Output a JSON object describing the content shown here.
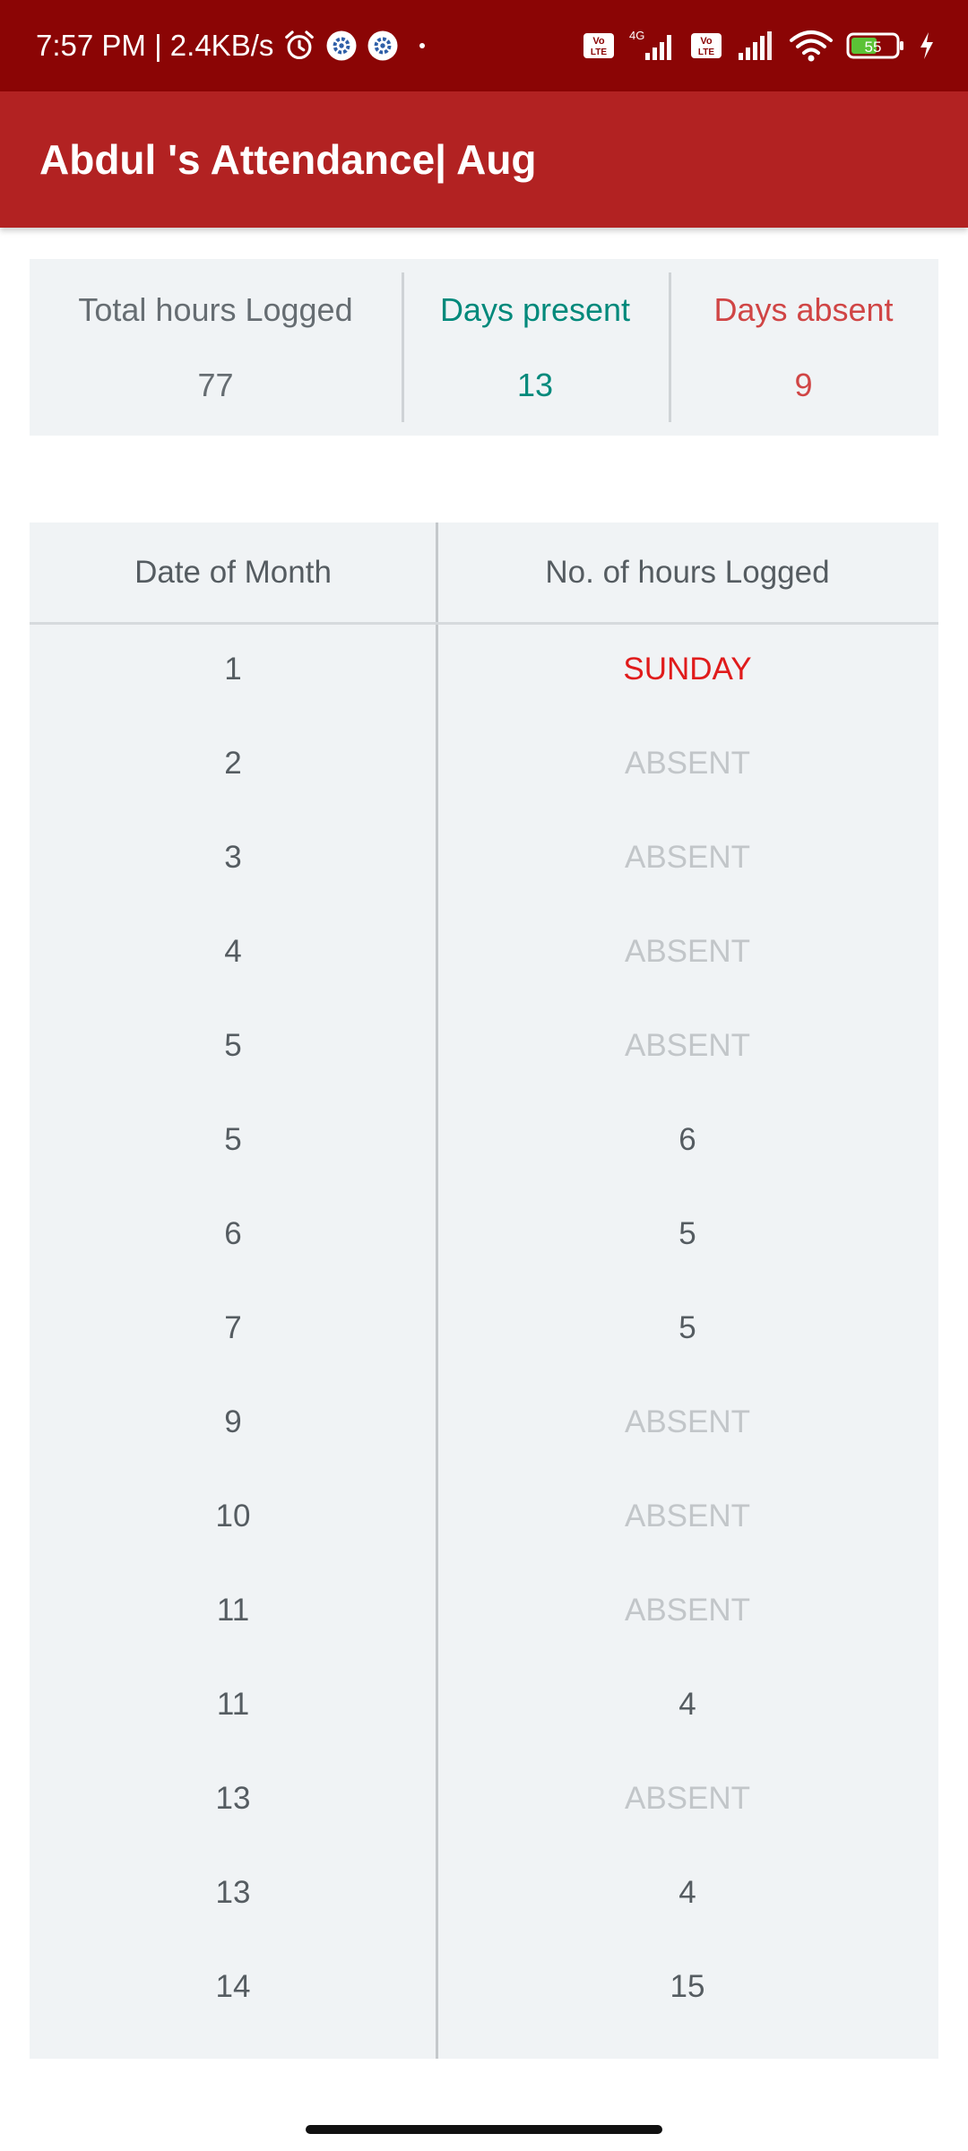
{
  "status_bar": {
    "time": "7:57 PM | 2.4KB/s",
    "battery": "55",
    "network_label": "4G",
    "volte": "Vo LTE"
  },
  "app_bar": {
    "title": "Abdul 's Attendance| Aug"
  },
  "summary": {
    "total_hours_label": "Total hours Logged",
    "total_hours_value": "77",
    "days_present_label": "Days present",
    "days_present_value": "13",
    "days_absent_label": "Days absent",
    "days_absent_value": "9"
  },
  "table": {
    "headers": [
      "Date of Month",
      "No. of hours Logged"
    ],
    "rows": [
      {
        "date": "1",
        "hours": "SUNDAY",
        "status": "sunday"
      },
      {
        "date": "2",
        "hours": "ABSENT",
        "status": "absent"
      },
      {
        "date": "3",
        "hours": "ABSENT",
        "status": "absent"
      },
      {
        "date": "4",
        "hours": "ABSENT",
        "status": "absent"
      },
      {
        "date": "5",
        "hours": "ABSENT",
        "status": "absent"
      },
      {
        "date": "5",
        "hours": "6",
        "status": "present"
      },
      {
        "date": "6",
        "hours": "5",
        "status": "present"
      },
      {
        "date": "7",
        "hours": "5",
        "status": "present"
      },
      {
        "date": "9",
        "hours": "ABSENT",
        "status": "absent"
      },
      {
        "date": "10",
        "hours": "ABSENT",
        "status": "absent"
      },
      {
        "date": "11",
        "hours": "ABSENT",
        "status": "absent"
      },
      {
        "date": "11",
        "hours": "4",
        "status": "present"
      },
      {
        "date": "13",
        "hours": "ABSENT",
        "status": "absent"
      },
      {
        "date": "13",
        "hours": "4",
        "status": "present"
      },
      {
        "date": "14",
        "hours": "15",
        "status": "present"
      }
    ]
  },
  "colors": {
    "status_bar_bg": "#8b0505",
    "app_bar_bg": "#b22222",
    "present_accent": "#00897b",
    "absent_accent": "#d04545",
    "sunday_text": "#e01b1b",
    "absent_text": "#c2c6c9"
  },
  "icons": [
    "alarm-icon",
    "settings-icon",
    "settings-icon",
    "signal-icon",
    "signal-icon",
    "wifi-icon",
    "battery-icon",
    "charging-icon"
  ]
}
